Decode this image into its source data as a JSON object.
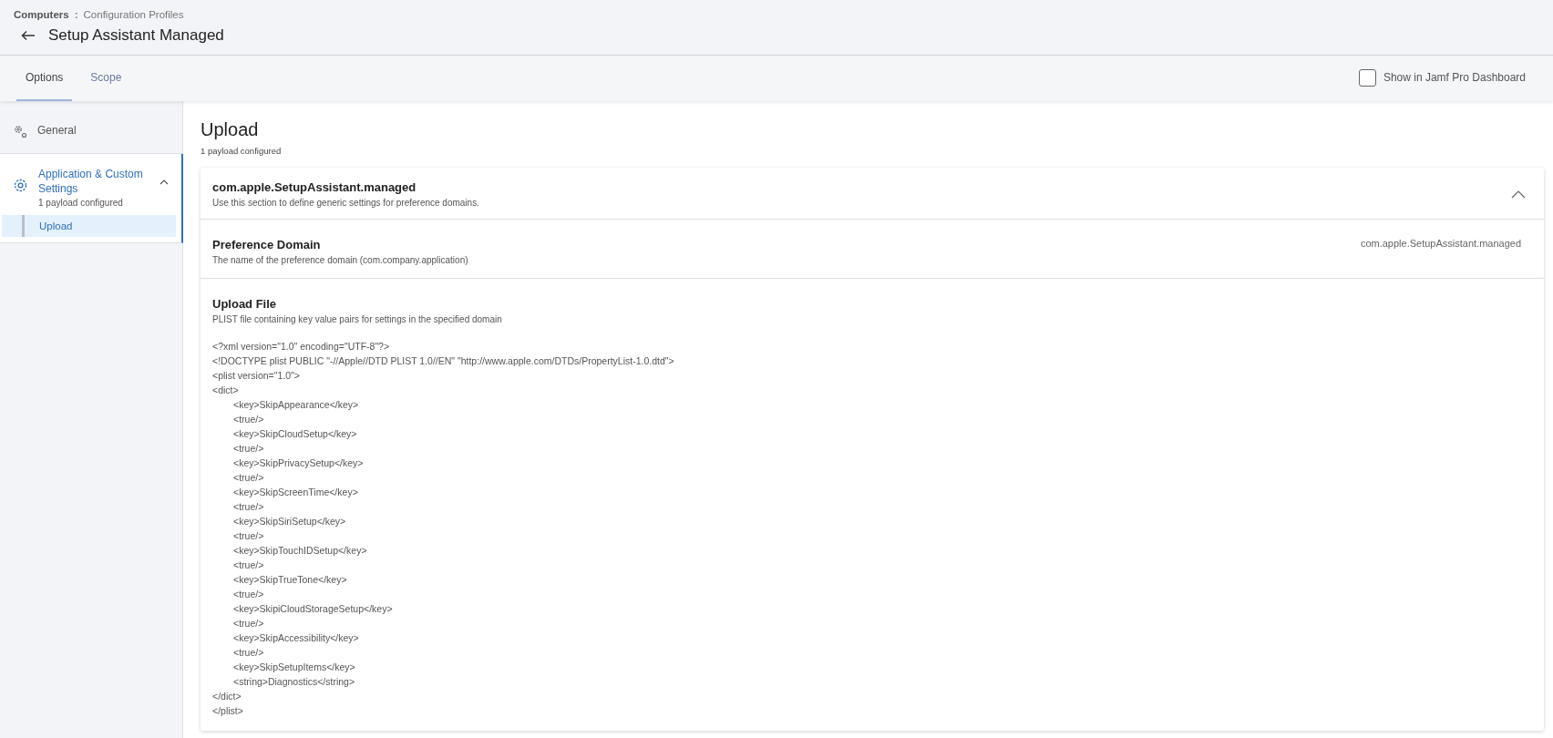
{
  "breadcrumb": {
    "parent": "Computers",
    "separator": ":",
    "current": "Configuration Profiles"
  },
  "page_title": "Setup Assistant Managed",
  "tabs": [
    {
      "label": "Options",
      "selected": true
    },
    {
      "label": "Scope",
      "selected": false
    }
  ],
  "dashboard_checkbox": {
    "label": "Show in Jamf Pro Dashboard",
    "checked": false
  },
  "sidebar": {
    "items": [
      {
        "label": "General",
        "kind": "general",
        "selected": false
      },
      {
        "label": "Application & Custom Settings",
        "subtitle": "1 payload configured",
        "kind": "settings",
        "selected": true,
        "expanded": true,
        "children": [
          {
            "label": "Upload",
            "selected": true
          }
        ]
      }
    ]
  },
  "content": {
    "title": "Upload",
    "subtitle": "1 payload configured",
    "section": {
      "title": "com.apple.SetupAssistant.managed",
      "description": "Use this section to define generic settings for preference domains.",
      "expanded": true,
      "fields": [
        {
          "kind": "value",
          "label": "Preference Domain",
          "description": "The name of the preference domain (com.company.application)",
          "value": "com.apple.SetupAssistant.managed"
        },
        {
          "kind": "code",
          "label": "Upload File",
          "description": "PLIST file containing key value pairs for settings in the specified domain",
          "lines": [
            {
              "text": "<?xml version=\"1.0\" encoding=\"UTF-8\"?>"
            },
            {
              "text": "<!DOCTYPE plist PUBLIC \"-//Apple//DTD PLIST 1.0//EN\" \"http://www.apple.com/DTDs/PropertyList-1.0.dtd\">"
            },
            {
              "text": "<plist version=\"1.0\">"
            },
            {
              "text": "<dict>",
              "children": [
                {
                  "text": "<key>SkipAppearance</key>"
                },
                {
                  "text": "<true/>"
                },
                {
                  "text": "<key>SkipCloudSetup</key>"
                },
                {
                  "text": "<true/>"
                },
                {
                  "text": "<key>SkipPrivacySetup</key>"
                },
                {
                  "text": "<true/>"
                },
                {
                  "text": "<key>SkipScreenTime</key>"
                },
                {
                  "text": "<true/>"
                },
                {
                  "text": "<key>SkipSiriSetup</key>"
                },
                {
                  "text": "<true/>"
                },
                {
                  "text": "<key>SkipTouchIDSetup</key>"
                },
                {
                  "text": "<true/>"
                },
                {
                  "text": "<key>SkipTrueTone</key>"
                },
                {
                  "text": "<true/>"
                },
                {
                  "text": "<key>SkipiCloudStorageSetup</key>"
                },
                {
                  "text": "<true/>"
                },
                {
                  "text": "<key>SkipAccessibility</key>"
                },
                {
                  "text": "<true/>"
                },
                {
                  "text": "<key>SkipSetupItems</key>"
                },
                {
                  "text": "<string>Diagnostics</string>"
                }
              ]
            },
            {
              "text": "</dict>"
            },
            {
              "text": "</plist>"
            }
          ]
        }
      ]
    }
  }
}
